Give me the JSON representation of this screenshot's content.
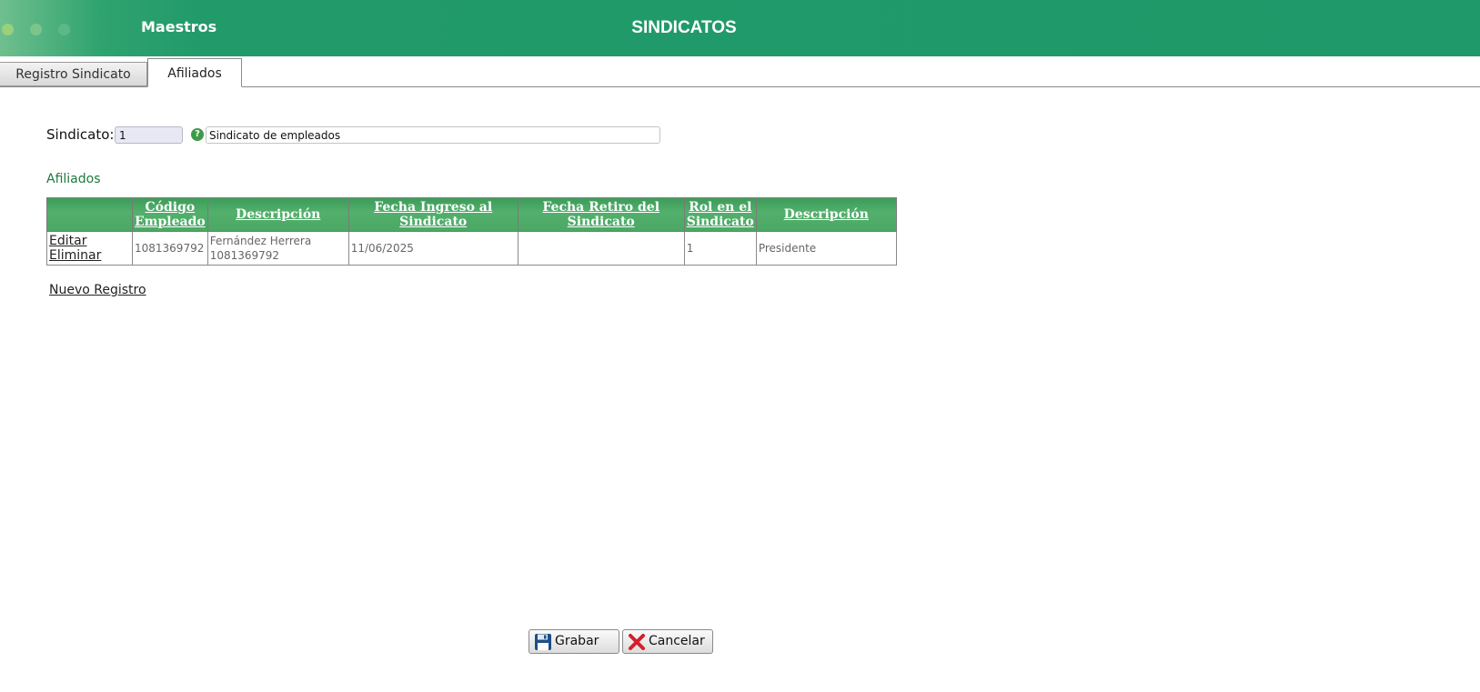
{
  "header": {
    "section": "Maestros",
    "title": "SINDICATOS",
    "colors": {
      "primary": "#1f9969",
      "accent": "#3d9c5a"
    }
  },
  "tabs": [
    {
      "label": "Registro Sindicato",
      "active": false
    },
    {
      "label": "Afiliados",
      "active": true
    }
  ],
  "form": {
    "sindicato_label": "Sindicato:",
    "codigo_value": "1",
    "descripcion_value": "Sindicato de empleados",
    "help_icon": "help-icon"
  },
  "section_title": "Afiliados",
  "table": {
    "headers": [
      "",
      "Código Empleado",
      "Descripción",
      "Fecha Ingreso al Sindicato",
      "Fecha Retiro del Sindicato",
      "Rol en el Sindicato",
      "Descripción"
    ],
    "rows": [
      {
        "edit_label": "Editar",
        "delete_label": "Eliminar",
        "codigo": "1081369792",
        "descripcion": "Fernández Herrera 1081369792",
        "fecha_ingreso": "11/06/2025",
        "fecha_retiro": "",
        "rol": "1",
        "rol_descripcion": "Presidente"
      }
    ]
  },
  "new_record_label": "Nuevo Registro",
  "buttons": {
    "save_label": "Grabar",
    "save_icon": "floppy-disk-icon",
    "cancel_label": "Cancelar",
    "cancel_icon": "red-x-icon"
  }
}
